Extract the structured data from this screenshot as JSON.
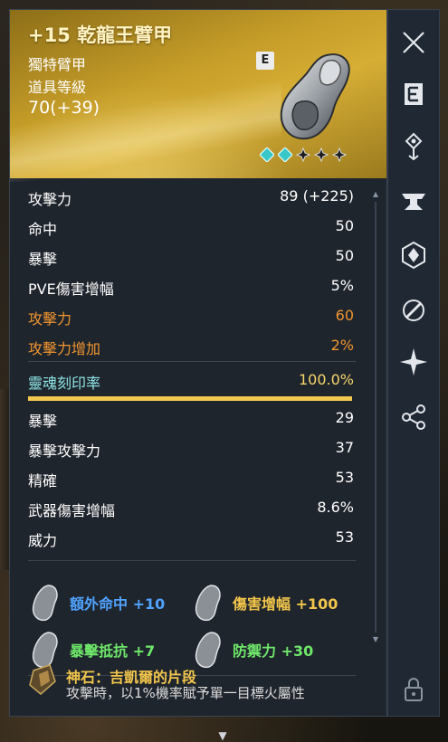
{
  "item": {
    "title": "+15 乾龍王臂甲",
    "type": "獨特臂甲",
    "level_label": "道具等級",
    "level": "70(+39)",
    "badge": "E",
    "enhance_stars_filled": 2,
    "enhance_stars_total": 5
  },
  "stats": [
    {
      "label": "攻擊力",
      "value": "89 (+225)",
      "style": "normal"
    },
    {
      "label": "命中",
      "value": "50",
      "style": "normal"
    },
    {
      "label": "暴擊",
      "value": "50",
      "style": "normal"
    },
    {
      "label": "PVE傷害增幅",
      "value": "5%",
      "style": "normal"
    },
    {
      "label": "攻擊力",
      "value": "60",
      "style": "orange"
    },
    {
      "label": "攻擊力增加",
      "value": "2%",
      "style": "orange"
    }
  ],
  "soul": {
    "label": "靈魂刻印率",
    "value": "100.0%",
    "fill_percent": 100
  },
  "soul_stats": [
    {
      "label": "暴擊",
      "value": "29"
    },
    {
      "label": "暴擊攻擊力",
      "value": "37"
    },
    {
      "label": "精確",
      "value": "53"
    },
    {
      "label": "武器傷害增幅",
      "value": "8.6%"
    },
    {
      "label": "威力",
      "value": "53"
    }
  ],
  "bonuses": [
    {
      "text": "額外命中 +10",
      "color": "#4fa3ff"
    },
    {
      "text": "傷害增幅 +100",
      "color": "#f3c64b"
    },
    {
      "text": "暴擊抵抗 +7",
      "color": "#6fe86a"
    },
    {
      "text": "防禦力 +30",
      "color": "#6fe86a"
    }
  ],
  "gem": {
    "name": "神石：吉凱爾的片段",
    "description": "攻擊時，以1%機率賦予單一目標火屬性"
  },
  "side_icons": [
    "close-icon",
    "e-icon",
    "tower-icon",
    "anvil-icon",
    "crystal-icon",
    "link-icon",
    "sparkle-icon",
    "share-icon",
    "lock-icon"
  ]
}
